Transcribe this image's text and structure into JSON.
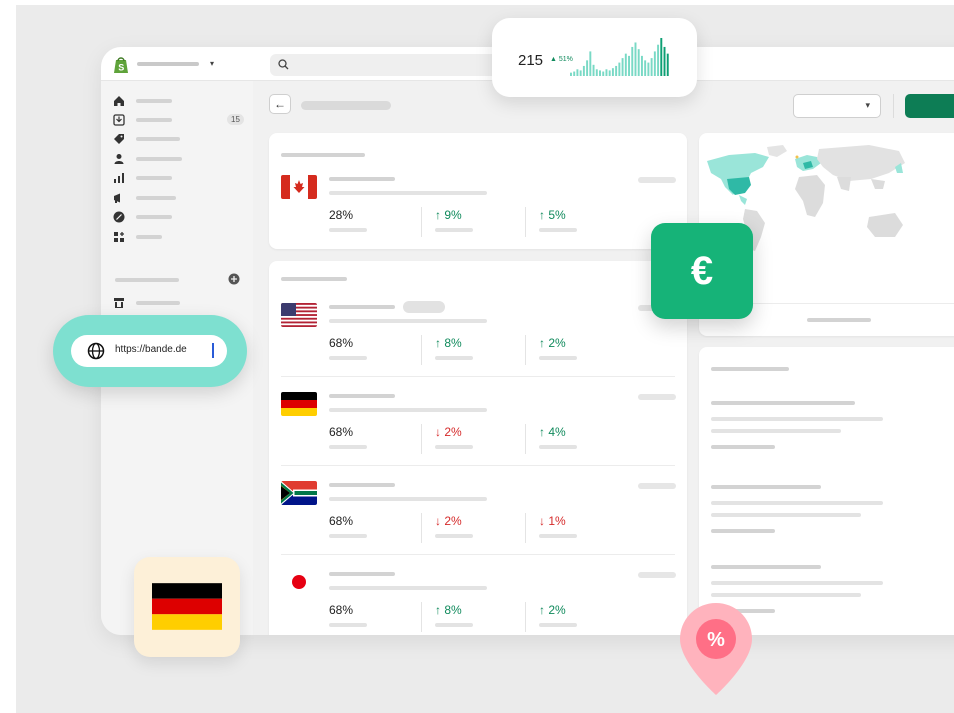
{
  "topbar": {
    "search_icon": "search-icon",
    "store_icon": "shopify-bag-icon"
  },
  "sidebar": {
    "items": [
      {
        "icon": "home-icon"
      },
      {
        "icon": "orders-icon",
        "badge": "15"
      },
      {
        "icon": "tag-icon"
      },
      {
        "icon": "person-icon"
      },
      {
        "icon": "analytics-icon"
      },
      {
        "icon": "megaphone-icon"
      },
      {
        "icon": "discount-icon"
      },
      {
        "icon": "apps-icon"
      }
    ],
    "section_add_icon": "plus-circle-icon",
    "store_item_icon": "store-icon"
  },
  "url_field": {
    "value": "https://bande.de",
    "icon": "globe-icon"
  },
  "sales_widget": {
    "value": "215",
    "change": "▲ 51%",
    "bars": [
      3,
      4,
      6,
      5,
      9,
      14,
      22,
      10,
      6,
      5,
      4,
      6,
      5,
      7,
      9,
      12,
      16,
      20,
      18,
      26,
      30,
      24,
      18,
      14,
      12,
      16,
      22,
      28,
      34,
      26,
      20
    ]
  },
  "markets": [
    {
      "country": "Canada",
      "flag": "canada-flag",
      "share": "28%",
      "metric2": "↑ 9%",
      "metric2_dir": "up",
      "metric3": "↑ 5%",
      "metric3_dir": "up"
    },
    {
      "country": "United States",
      "flag": "us-flag",
      "share": "68%",
      "metric2": "↑ 8%",
      "metric2_dir": "up",
      "metric3": "↑ 2%",
      "metric3_dir": "up"
    },
    {
      "country": "Germany",
      "flag": "germany-flag",
      "share": "68%",
      "metric2": "↓ 2%",
      "metric2_dir": "down",
      "metric3": "↑ 4%",
      "metric3_dir": "up"
    },
    {
      "country": "South Africa",
      "flag": "south-africa-flag",
      "share": "68%",
      "metric2": "↓ 2%",
      "metric2_dir": "down",
      "metric3": "↓ 1%",
      "metric3_dir": "down"
    },
    {
      "country": "Japan",
      "flag": "japan-flag",
      "share": "68%",
      "metric2": "↑ 8%",
      "metric2_dir": "up",
      "metric3": "↑ 2%",
      "metric3_dir": "up"
    }
  ],
  "currency_badge": {
    "symbol": "€"
  },
  "discount_pin": {
    "symbol": "%"
  },
  "colors": {
    "brand_green": "#0d7d55",
    "teal": "#7ee0d0",
    "up": "#108a5c",
    "down": "#d52a2a",
    "euro_tile": "#16b378"
  }
}
